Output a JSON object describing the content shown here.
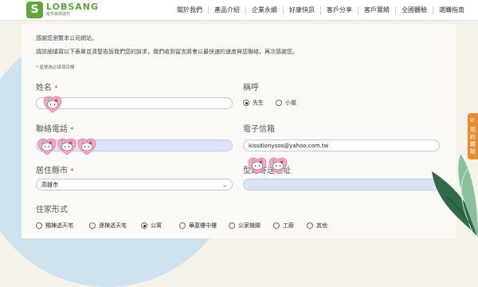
{
  "header": {
    "logo_mark": "S",
    "logo_name": "LOBSANG",
    "logo_sub": "羅布森綠建材",
    "nav": [
      "關於我們",
      "產品介紹",
      "企業永續",
      "好康快訊",
      "客戶分享",
      "客戶實績",
      "全國體驗",
      "選購指南"
    ]
  },
  "intro": {
    "line1": "感謝您瀏覽本公司網站，",
    "line2": "請詳細填寫以下表單並清楚告訴我們您的訴求，我們收到留言將會以最快速的速度與您聯絡，再次感謝您。",
    "required_note": "星號為必填項目欄"
  },
  "form": {
    "name_label": "姓名",
    "title_label": "稱呼",
    "title_options": [
      "先生",
      "小姐"
    ],
    "title_selected": "先生",
    "phone_label": "聯絡電話",
    "email_label": "電子信箱",
    "email_value": "kissdionysos@yahoo.com.tw",
    "city_label": "居住縣市",
    "city_value": "高雄市",
    "catalog_label": "型錄寄送地址",
    "housing_label": "住家形式",
    "housing_options": [
      "獨棟透天宅",
      "連棟透天宅",
      "公寓",
      "華廈樓中樓",
      "公家機關",
      "工廠",
      "其他"
    ],
    "housing_selected": "公寓"
  },
  "side_tab": {
    "label": "預約體驗",
    "icon": "phone-icon"
  },
  "colors": {
    "brand": "#5fa53b",
    "accent": "#e98a2f",
    "required": "#e0431f"
  }
}
